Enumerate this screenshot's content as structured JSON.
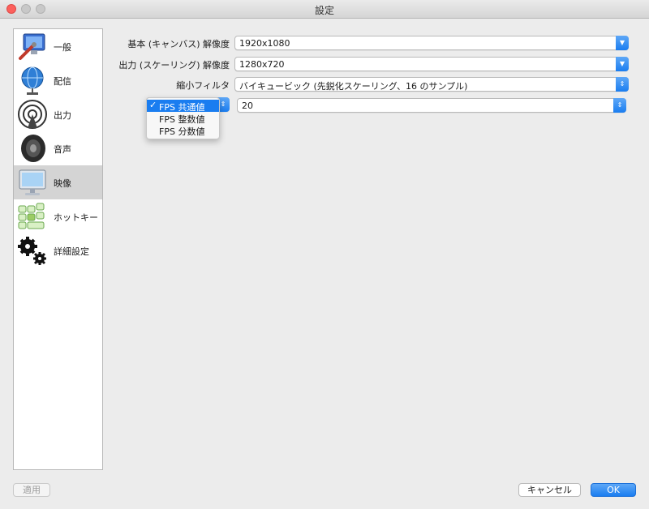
{
  "window": {
    "title": "設定"
  },
  "sidebar": {
    "items": [
      {
        "label": "一般",
        "icon": "monitor-wrench-icon"
      },
      {
        "label": "配信",
        "icon": "globe-network-icon"
      },
      {
        "label": "出力",
        "icon": "broadcast-antenna-icon"
      },
      {
        "label": "音声",
        "icon": "speaker-icon"
      },
      {
        "label": "映像",
        "icon": "display-icon",
        "selected": true
      },
      {
        "label": "ホットキー",
        "icon": "keyboard-icon"
      },
      {
        "label": "詳細設定",
        "icon": "gears-icon"
      }
    ]
  },
  "video": {
    "base_resolution": {
      "label": "基本 (キャンバス) 解像度",
      "value": "1920x1080"
    },
    "output_resolution": {
      "label": "出力 (スケーリング) 解像度",
      "value": "1280x720"
    },
    "downscale_filter": {
      "label": "縮小フィルタ",
      "value": "バイキュービック (先鋭化スケーリング、16 のサンプル)"
    },
    "fps": {
      "type_value": "FPS 共通値",
      "value": "20",
      "options": [
        "FPS 共通値",
        "FPS 整数値",
        "FPS 分数値"
      ],
      "selected_index": 0
    }
  },
  "buttons": {
    "apply": "適用",
    "cancel": "キャンセル",
    "ok": "OK"
  },
  "colors": {
    "accent": "#1a7df0",
    "selected_row": "#d4d4d4",
    "close": "#fc605c"
  }
}
